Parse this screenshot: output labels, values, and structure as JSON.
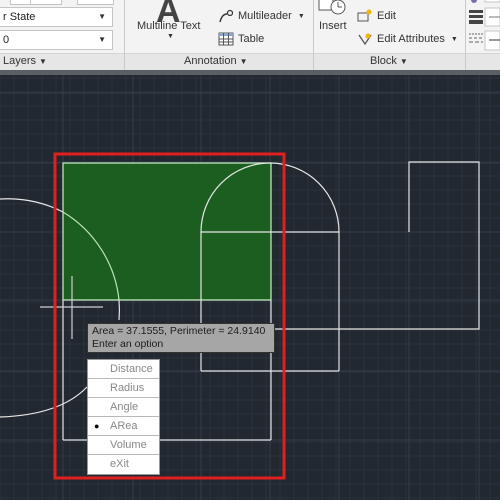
{
  "ribbon": {
    "layers_panel": {
      "combo_layer_state": "r State",
      "combo_layer": "0",
      "label": "Layers"
    },
    "annotation_panel": {
      "multiline_text_label": "Multiline Text",
      "multileader_label": "Multileader",
      "table_label": "Table",
      "label": "Annotation"
    },
    "block_panel": {
      "insert_label": "Insert",
      "edit_label": "Edit",
      "edit_attributes_label": "Edit Attributes",
      "label": "Block"
    }
  },
  "canvas": {
    "colors": {
      "background": "#212830",
      "hatch_fill": "#1b5e20",
      "highlight_box": "#e02020",
      "lines": "#e8e8e8"
    },
    "tooltip": {
      "line1": "Area = 37.1555, Perimeter = 24.9140",
      "line2": "Enter an option"
    },
    "option_menu": {
      "items": [
        {
          "label": "Distance",
          "selected": false
        },
        {
          "label": "Radius",
          "selected": false
        },
        {
          "label": "Angle",
          "selected": false
        },
        {
          "label": "ARea",
          "selected": true
        },
        {
          "label": "Volume",
          "selected": false
        },
        {
          "label": "eXit",
          "selected": false
        }
      ],
      "bullet": "●"
    }
  }
}
